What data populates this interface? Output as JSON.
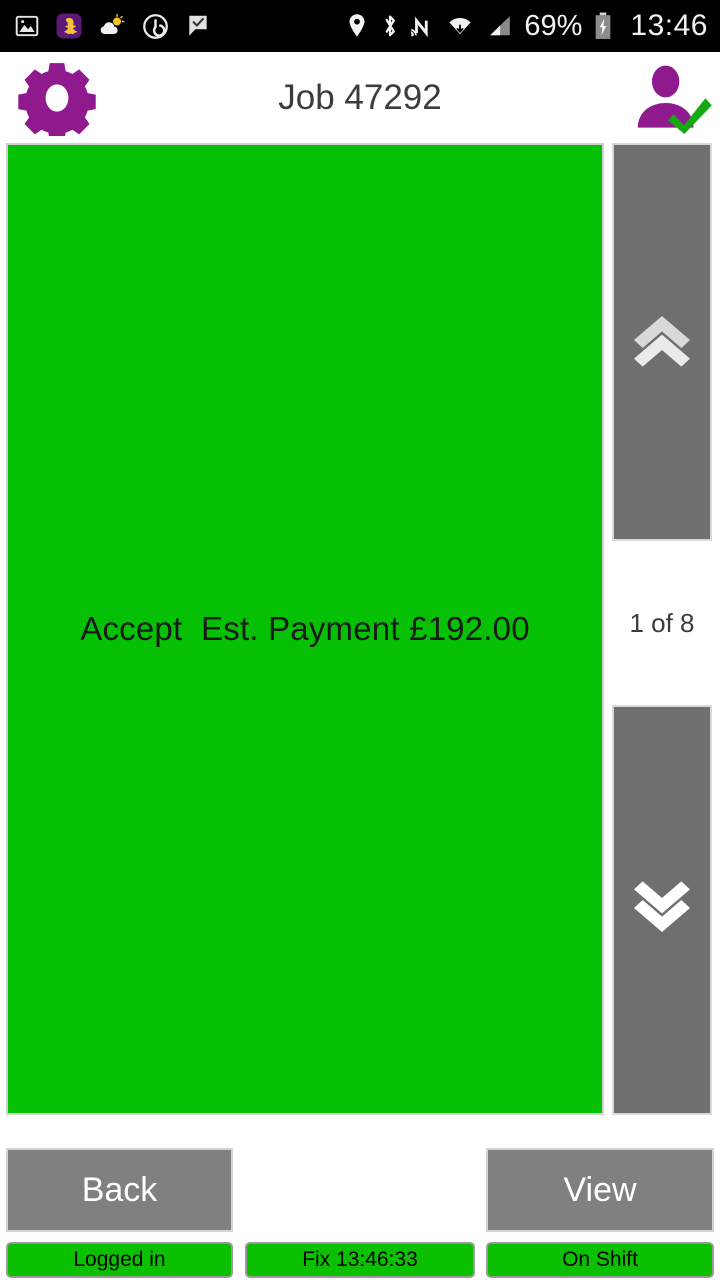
{
  "statusbar": {
    "time": "13:46",
    "battery_percent": "69%",
    "left_icons": [
      {
        "name": "photo-icon"
      },
      {
        "name": "snapchat-app-icon"
      },
      {
        "name": "weather-cloud-sun-icon"
      },
      {
        "name": "power-circle-icon"
      },
      {
        "name": "checkmark-flag-icon"
      }
    ],
    "right_icons": [
      {
        "name": "location-pin-icon"
      },
      {
        "name": "bluetooth-icon"
      },
      {
        "name": "nfc-icon"
      },
      {
        "name": "wifi-icon"
      },
      {
        "name": "cellular-signal-icon"
      },
      {
        "name": "battery-charging-icon"
      }
    ]
  },
  "header": {
    "title": "Job 47292",
    "gear_icon": "gear-icon",
    "user_icon": "user-accepted-icon",
    "purple": "#8e1a8e",
    "check_green": "#14a814"
  },
  "main": {
    "accept_panel": {
      "label": "Accept  Est. Payment £192.00",
      "background": "#06c006",
      "text_color": "#1a1a1a"
    },
    "scroll_up": {
      "icon": "double-chevron-up-icon",
      "background": "#6f6f6f"
    },
    "scroll_down": {
      "icon": "double-chevron-down-icon",
      "background": "#6f6f6f"
    },
    "pager": {
      "label": "1 of 8",
      "current": 1,
      "total": 8
    }
  },
  "actions": {
    "back_label": "Back",
    "view_label": "View",
    "button_background": "#808080"
  },
  "status_strip": {
    "login_state": "Logged in",
    "fix_time": "Fix 13:46:33",
    "shift_state": "On Shift",
    "background": "#0ac000"
  }
}
